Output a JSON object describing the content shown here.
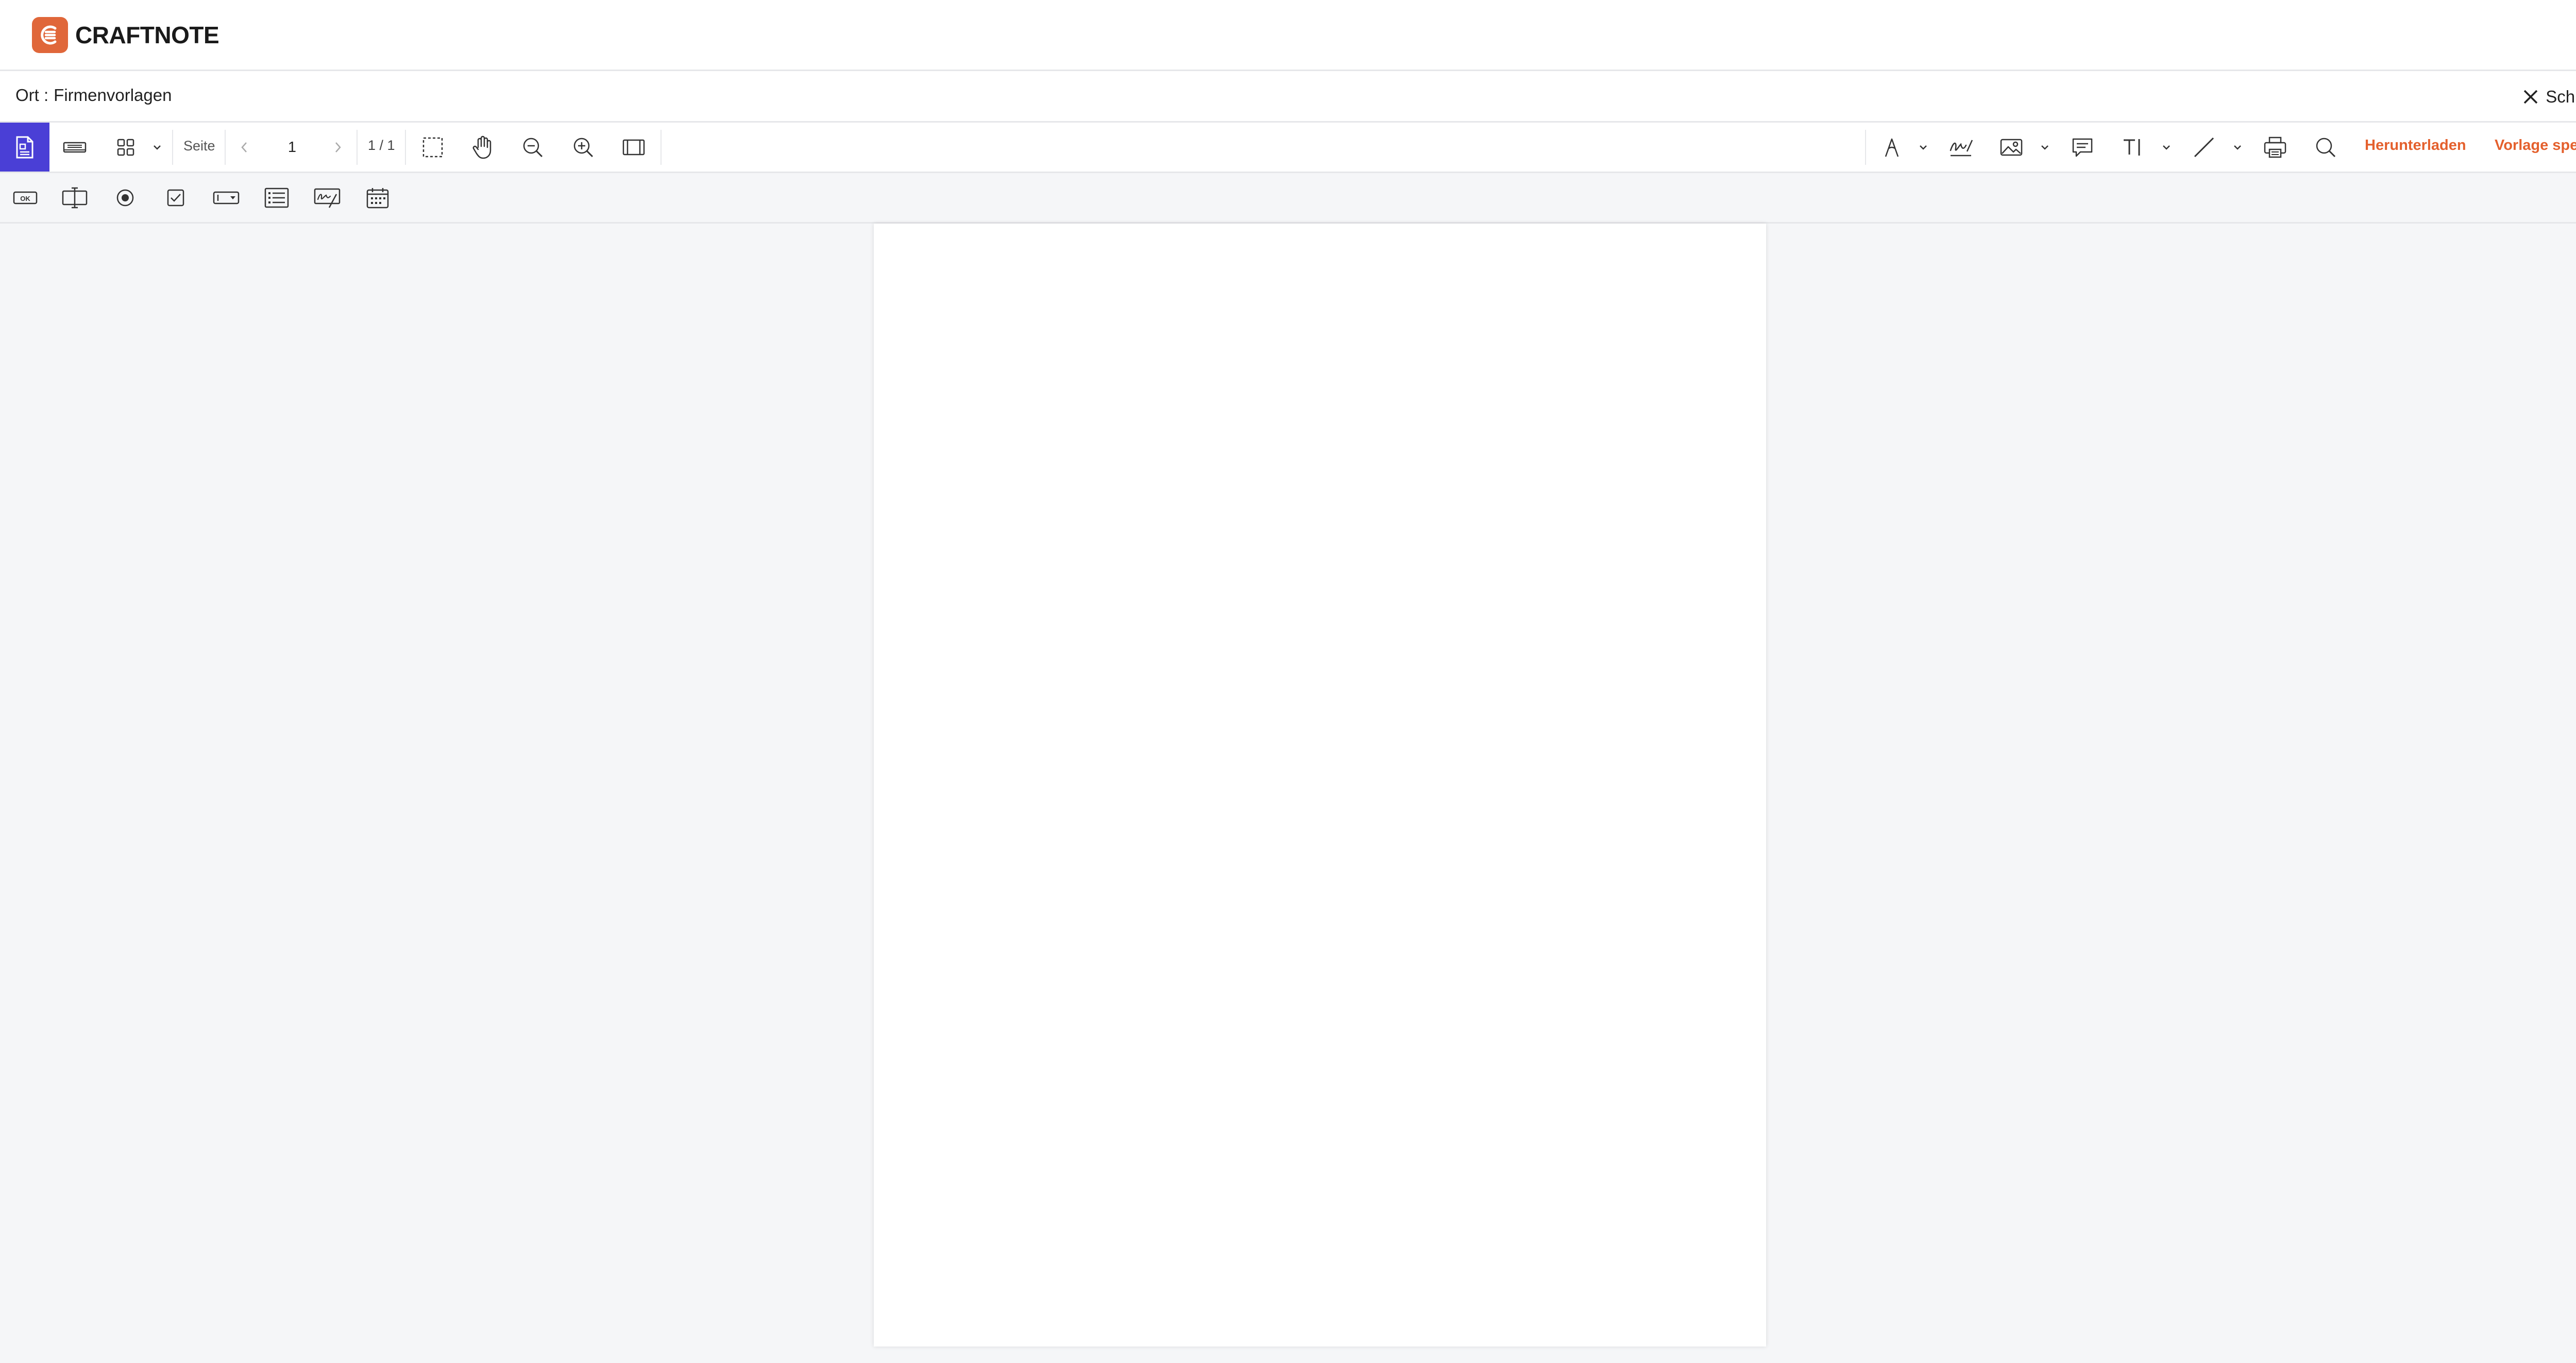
{
  "app": {
    "brand": "CRAFTNOTE",
    "brand_color": "#e0673a",
    "accent_color": "#4a3fd6",
    "action_color": "#e4602d"
  },
  "location": {
    "label": "Ort :",
    "value": "Firmenvorlagen",
    "close_label": "Schließen"
  },
  "toolbar": {
    "page_label": "Seite",
    "current_page": "1",
    "page_count": "1 / 1",
    "download_label": "Herunterladen",
    "save_template_label": "Vorlage speichern",
    "icons_left": [
      "document-properties-icon",
      "form-field-icon",
      "grid-view-icon",
      "chevron-down-icon",
      "previous-page-icon",
      "next-page-icon",
      "marquee-select-icon",
      "pan-hand-icon",
      "zoom-out-icon",
      "zoom-in-icon",
      "fit-width-icon"
    ],
    "icons_right": [
      "pen-icon",
      "chevron-down-icon",
      "signature-icon",
      "image-icon",
      "chevron-down-icon",
      "comment-icon",
      "text-tool-icon",
      "chevron-down-icon",
      "line-tool-icon",
      "chevron-down-icon",
      "print-icon",
      "search-icon"
    ]
  },
  "form_toolbar": {
    "icons": [
      "button-field-icon",
      "text-field-icon",
      "radio-button-icon",
      "checkbox-icon",
      "dropdown-field-icon",
      "list-box-icon",
      "signature-field-icon",
      "date-field-icon"
    ],
    "button_text": "OK"
  }
}
